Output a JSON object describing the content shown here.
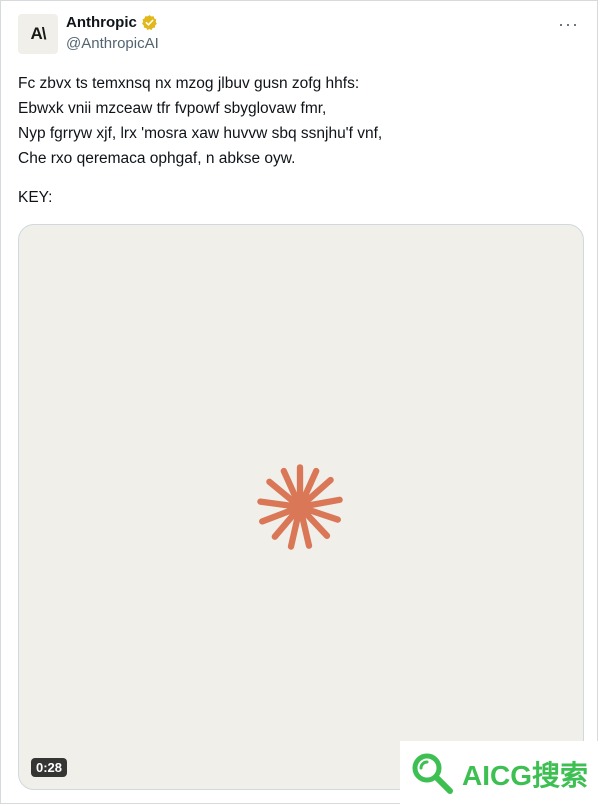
{
  "tweet": {
    "avatar_text": "A\\",
    "display_name": "Anthropic",
    "handle": "@AnthropicAI",
    "verified_badge_color": "#e2b719",
    "more_label": "···",
    "lines": [
      "Fc zbvx ts temxnsq nx mzog jlbuv gusn zofg hhfs:",
      "Ebwxk vnii mzceaw tfr fvpowf sbyglovaw fmr,",
      "Nyp fgrryw xjf, lrx 'mosra xaw huvvw sbq ssnjhu'f vnf,",
      "Che rxo qeremaca ophgaf, n abkse oyw."
    ],
    "key_label": "KEY:"
  },
  "media": {
    "duration": "0:28",
    "icon": "burst-logo-icon",
    "accent_color": "#d97757",
    "background_color": "#f0efea"
  },
  "watermark": {
    "text": "AICG搜索",
    "color": "#3dbf52"
  }
}
